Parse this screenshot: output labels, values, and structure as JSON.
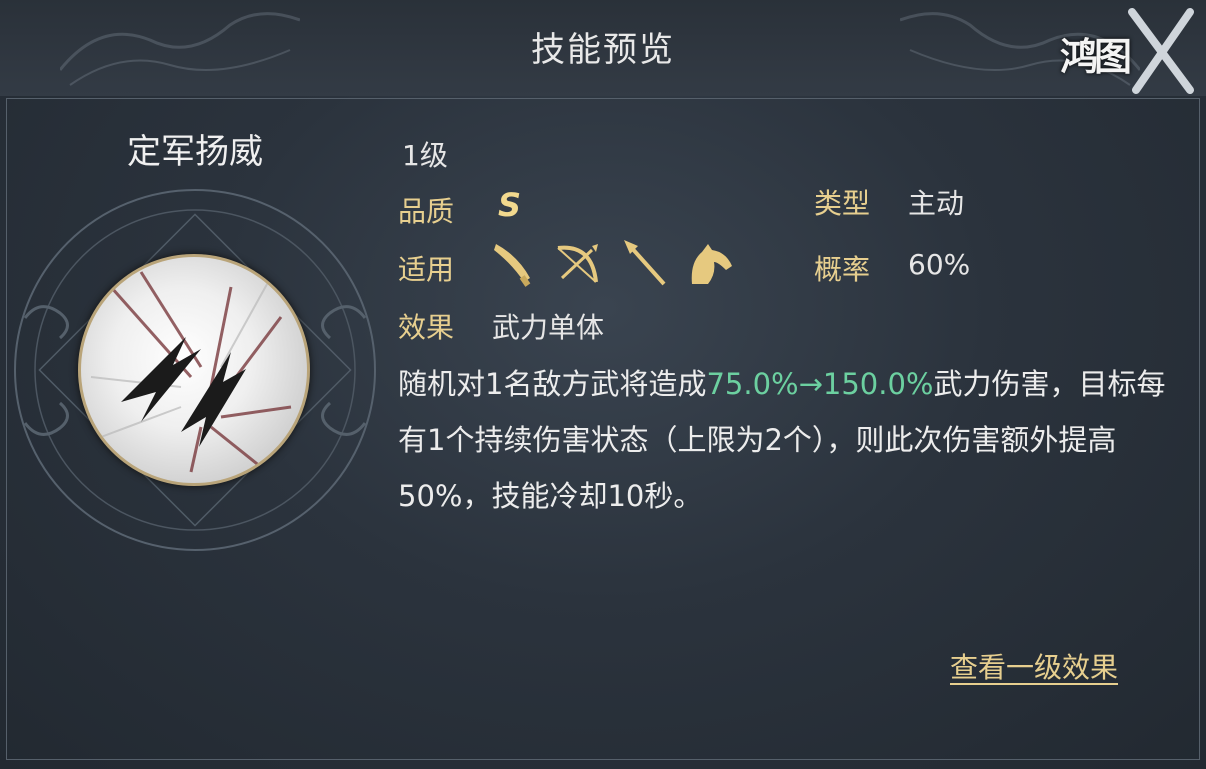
{
  "window": {
    "title": "技能预览"
  },
  "logo": {
    "text": "鸿图"
  },
  "skill": {
    "name": "定军扬威",
    "level": "1级",
    "quality_label": "品质",
    "quality_value": "S",
    "type_label": "类型",
    "type_value": "主动",
    "applicable_label": "适用",
    "applicable_units": [
      "saber-icon",
      "bow-icon",
      "spear-icon",
      "horse-icon"
    ],
    "chance_label": "概率",
    "chance_value": "60%",
    "effect_label": "效果",
    "effect_value": "武力单体",
    "description": {
      "part1": "随机对1名敌方武将造成",
      "highlight": "75.0%→150.0%",
      "part2": "武力伤害，目标每有1个持续伤害状态（上限为2个），则此次伤害额外提高50%，技能冷却10秒。"
    }
  },
  "actions": {
    "view_level1": "查看一级效果"
  },
  "colors": {
    "label": "#e7cf8f",
    "highlight": "#6cd0a0",
    "text": "#e6e6e6"
  }
}
